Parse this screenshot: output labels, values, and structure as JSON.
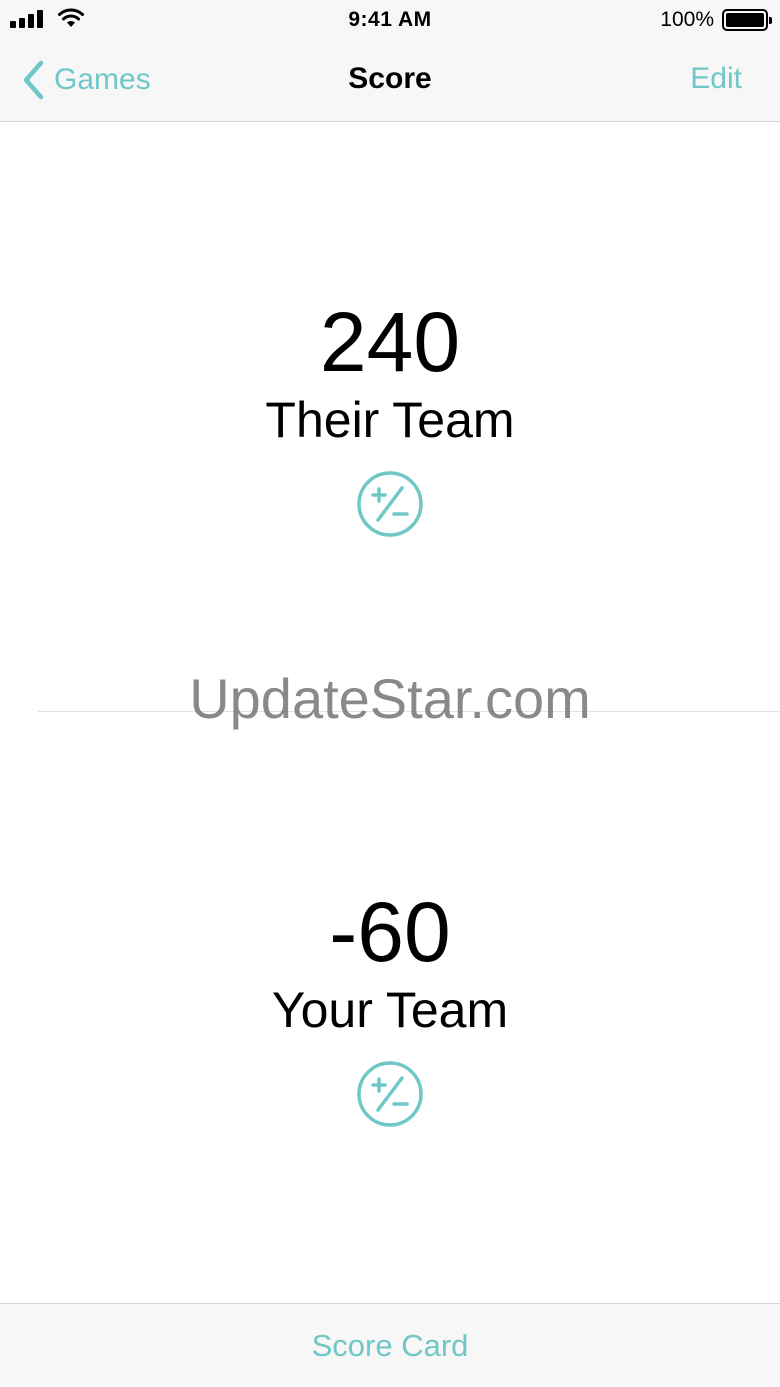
{
  "status_bar": {
    "time": "9:41 AM",
    "battery_percent": "100%",
    "battery_level": 1.0,
    "signal_icon": "cellular-signal-icon",
    "wifi_icon": "wifi-icon",
    "battery_icon": "battery-icon"
  },
  "nav": {
    "back_label": "Games",
    "title": "Score",
    "edit_label": "Edit",
    "back_icon": "chevron-left-icon"
  },
  "teams": [
    {
      "score": "240",
      "name": "Their Team",
      "adjust_icon": "plus-minus-icon"
    },
    {
      "score": "-60",
      "name": "Your Team",
      "adjust_icon": "plus-minus-icon"
    }
  ],
  "watermark": "UpdateStar.com",
  "tab_bar": {
    "label": "Score Card"
  },
  "colors": {
    "accent": "#6fc7c7",
    "bar_background": "#f7f7f7"
  }
}
